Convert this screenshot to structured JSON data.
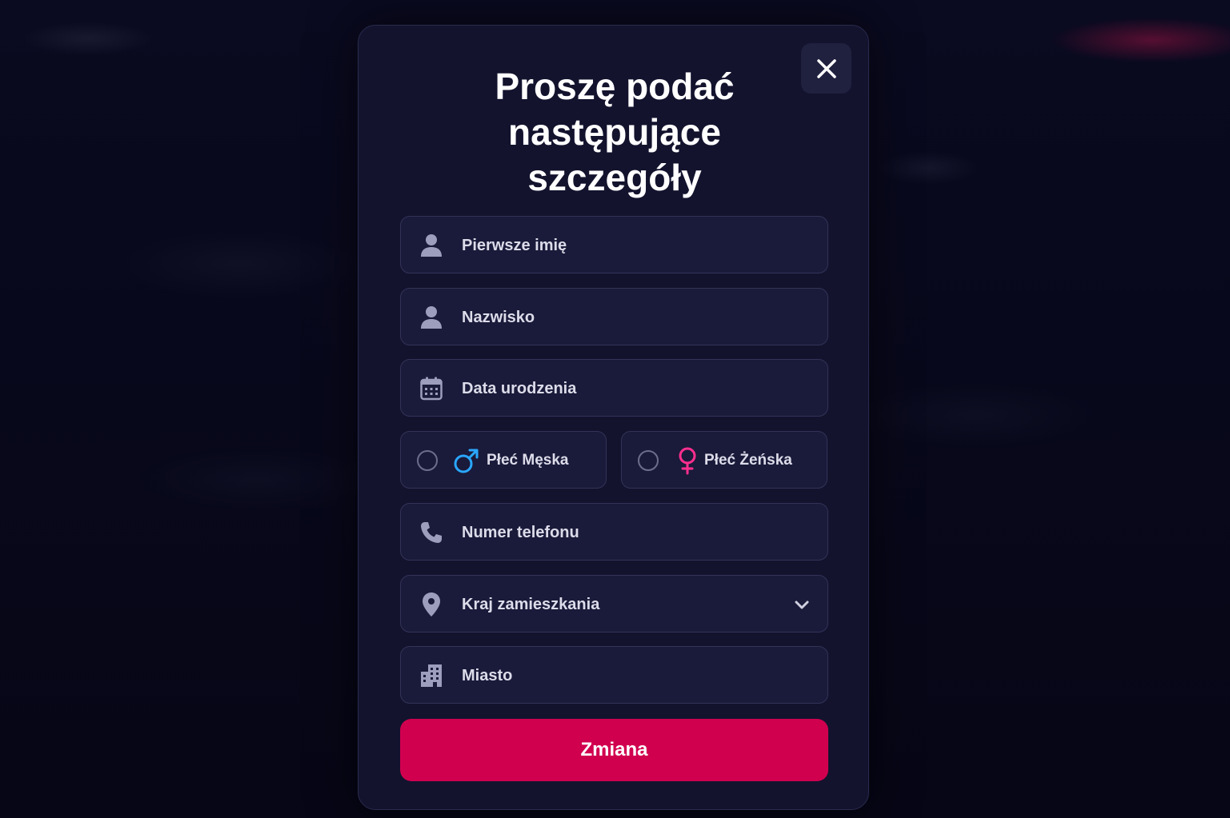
{
  "modal": {
    "title": "Proszę podać następujące szczegóły",
    "close_icon": "close-icon"
  },
  "fields": {
    "first_name": {
      "placeholder": "Pierwsze imię",
      "icon": "user-icon"
    },
    "last_name": {
      "placeholder": "Nazwisko",
      "icon": "user-icon"
    },
    "birth_date": {
      "placeholder": "Data urodzenia",
      "icon": "calendar-icon"
    },
    "phone": {
      "placeholder": "Numer telefonu",
      "icon": "phone-icon"
    },
    "country": {
      "placeholder": "Kraj zamieszkania",
      "icon": "map-pin-icon"
    },
    "city": {
      "placeholder": "Miasto",
      "icon": "building-icon"
    }
  },
  "gender": {
    "male": {
      "label": "Płeć Męska",
      "icon": "male-icon",
      "color": "#2aa7ff"
    },
    "female": {
      "label": "Płeć Żeńska",
      "icon": "female-icon",
      "color": "#ff2f8e"
    }
  },
  "submit": {
    "label": "Zmiana",
    "color": "#d1004f"
  }
}
